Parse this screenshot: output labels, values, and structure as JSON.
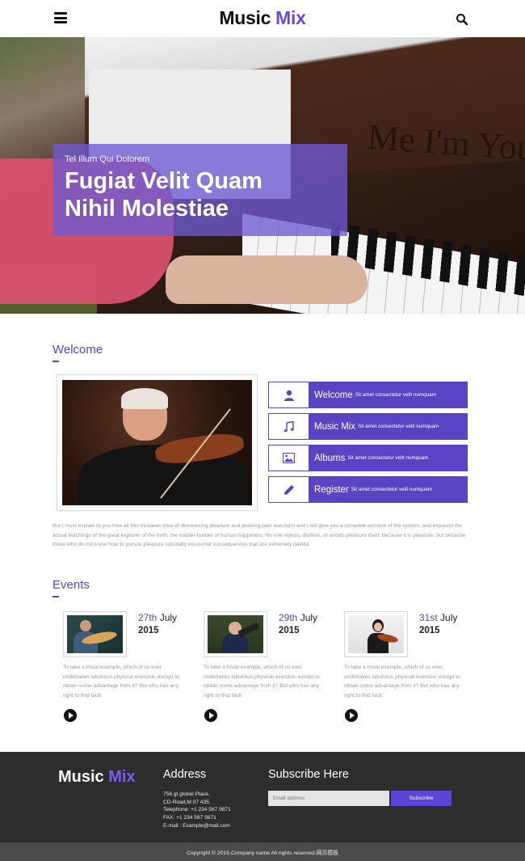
{
  "header": {
    "logo_main": "Music",
    "logo_accent": "Mix"
  },
  "hero": {
    "subtitle": "Tel Illum Qui Dolorem",
    "title_line1": "Fugiat Velit Quam",
    "title_line2": "Nihil Molestiae",
    "engraving": "Me I'm You"
  },
  "welcome": {
    "heading": "Welcome",
    "features": [
      {
        "title": "Welcome",
        "subtitle": "Sit amet consectetur velit numquam",
        "icon": "user-icon"
      },
      {
        "title": "Music Mix",
        "subtitle": "Sit amet consectetur velit numquam",
        "icon": "music-note-icon"
      },
      {
        "title": "Albums",
        "subtitle": "Sit amet consectetur velit numquam",
        "icon": "picture-icon"
      },
      {
        "title": "Register",
        "subtitle": "Sit amet consectetur velit numquam",
        "icon": "pencil-icon"
      }
    ],
    "paragraph": "But I must explain to you how all this mistaken idea of denouncing pleasure and praising pain was born and I will give you a complete account of the system, and expound the actual teachings of the great explorer of the truth, the master-builder of human happiness. No one rejects, dislikes, or avoids pleasure itself, because it is pleasure, but because those who do not know how to pursue pleasure rationally encounter consequences that are extremely painful."
  },
  "events": {
    "heading": "Events",
    "items": [
      {
        "day": "27th",
        "month": "July",
        "year": "2015",
        "text": "To take a trivial example, which of us ever undertakes laborious physical exercise, except to obtain some advantage from it? But who has any right to find fault"
      },
      {
        "day": "29th",
        "month": "July",
        "year": "2015",
        "text": "To take a trivial example, which of us ever undertakes laborious physical exercise, except to obtain some advantage from it? But who has any right to find fault"
      },
      {
        "day": "31st",
        "month": "July",
        "year": "2015",
        "text": "To take a trivial example, which of us ever undertakes laborious physical exercise, except to obtain some advantage from it? But who has any right to find fault"
      }
    ]
  },
  "footer": {
    "logo_main": "Music",
    "logo_accent": "Mix",
    "address_heading": "Address",
    "address_lines": [
      "756 gt globel Place,",
      "CD-Road,M 07 435.",
      "Telephone: +1 234 567 9871",
      "FAX: +1 234 567 9871",
      "E-mail : Example@mail.com"
    ],
    "subscribe_heading": "Subscribe Here",
    "email_placeholder": "Email address",
    "subscribe_button": "Subscribe",
    "copyright": "Copyright © 2015.Company name All rights reserved.网页模板"
  },
  "colors": {
    "accent": "#5b44c4",
    "footer_bg": "#2d2d2d",
    "copyright_bg": "#4a4a4a"
  }
}
